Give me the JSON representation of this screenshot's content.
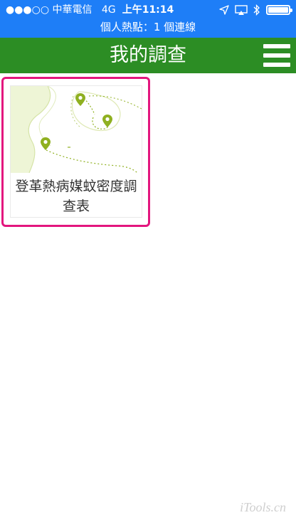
{
  "status_bar": {
    "carrier": "●●●○○ 中華電信",
    "network": "4G",
    "time": "上午11:14",
    "hotspot": "個人熱點：1 個連線",
    "icons": [
      "location-arrow-icon",
      "airplay-icon",
      "bluetooth-icon",
      "battery-icon"
    ]
  },
  "header": {
    "title": "我的調查",
    "menu_icon": "hamburger-menu-icon"
  },
  "surveys": [
    {
      "title": "登革熱病媒蚊密度調查表",
      "thumbnail_icon": "map-with-pins-icon"
    }
  ],
  "watermark": "iTools.cn",
  "colors": {
    "status_bar": "#1e7ef7",
    "app_bar": "#2c8d24",
    "highlight_border": "#e3167e",
    "map_fill": "#eef5d6",
    "pin": "#8fb020"
  }
}
